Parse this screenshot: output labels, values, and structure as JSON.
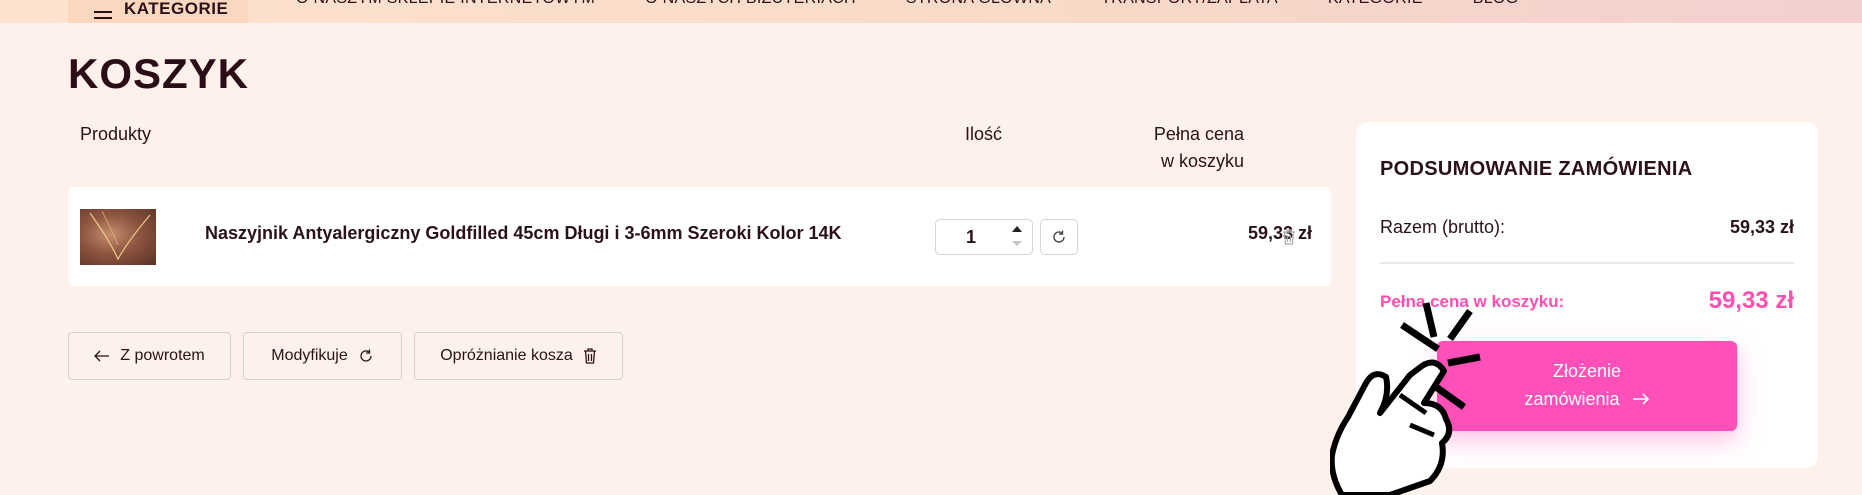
{
  "nav": {
    "categories_button": "KATEGORIE",
    "links": [
      "O NASZYM SKLEPIE INTERNETOWYM",
      "O NASZYCH BIŻUTERIACH",
      "STRONA GŁÓWNA",
      "TRANSPORT/ZAPŁATA",
      "KATEGORIE",
      "BLOG"
    ]
  },
  "page": {
    "title": "KOSZYK"
  },
  "cart": {
    "headers": {
      "products": "Produkty",
      "quantity": "Ilość",
      "price_line1": "Pełna cena",
      "price_line2": "w koszyku"
    },
    "items": [
      {
        "name": "Naszyjnik Antyalergiczny Goldfilled 45cm Długi i 3-6mm Szeroki Kolor 14K",
        "quantity": "1",
        "price": "59,33 zł"
      }
    ]
  },
  "actions": {
    "back": "Z powrotem",
    "modify": "Modyfikuje",
    "empty": "Opróżnianie kosza"
  },
  "summary": {
    "title": "PODSUMOWANIE ZAMÓWIENIA",
    "subtotal_label": "Razem (brutto):",
    "subtotal_value": "59,33 zł",
    "total_label": "Pełna cena w koszyku:",
    "total_value": "59,33 zł",
    "order_button_line1": "Złożenie",
    "order_button_line2": "zamówienia"
  },
  "colors": {
    "accent": "#ff4fb9",
    "accent_text": "#ff4fb0",
    "background": "#fef0ea"
  },
  "icons": [
    "menu-icon",
    "refresh-icon",
    "trash-icon",
    "arrow-left-icon",
    "arrow-right-icon",
    "hand-pointer-icon"
  ]
}
